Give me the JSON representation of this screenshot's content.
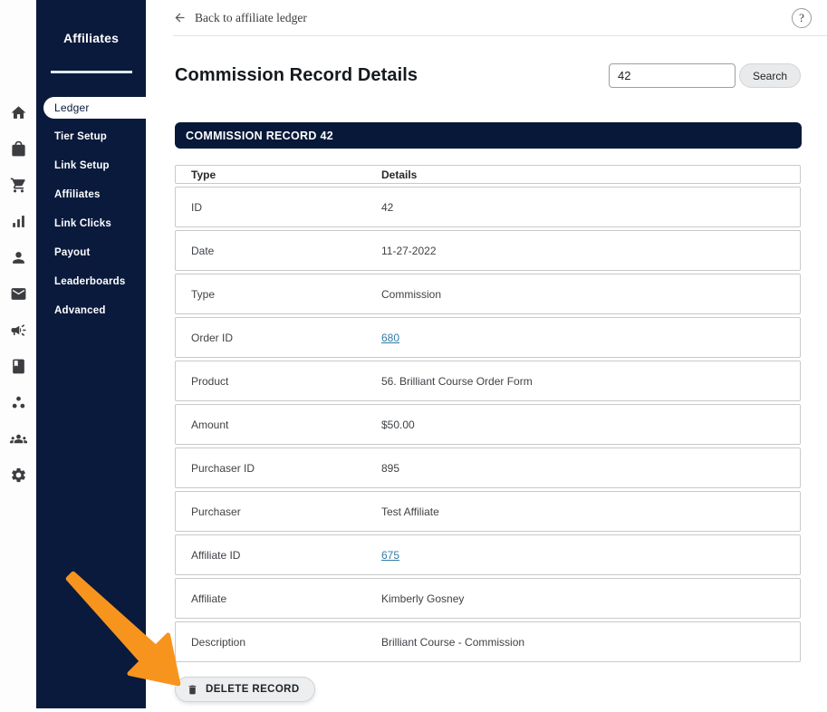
{
  "colors": {
    "navy": "#0A1A3C",
    "panel_navy": "#071838",
    "accent_orange": "#F7941E",
    "link_blue": "#337CA8"
  },
  "rail": {
    "icons": [
      "home-icon",
      "shop-icon",
      "cart-icon",
      "bar-chart-icon",
      "person-icon",
      "mail-icon",
      "megaphone-icon",
      "book-icon",
      "cluster-icon",
      "people-icon",
      "gear-icon"
    ]
  },
  "sidebar": {
    "title": "Affiliates",
    "items": [
      {
        "label": "Ledger",
        "active": true
      },
      {
        "label": "Tier Setup"
      },
      {
        "label": "Link Setup"
      },
      {
        "label": "Affiliates"
      },
      {
        "label": "Link Clicks"
      },
      {
        "label": "Payout"
      },
      {
        "label": "Leaderboards"
      },
      {
        "label": "Advanced"
      }
    ]
  },
  "topbar": {
    "back_label": "Back to affiliate ledger",
    "help_label": "?"
  },
  "header": {
    "title": "Commission Record Details",
    "search_value": "42",
    "search_button": "Search"
  },
  "panel": {
    "title": "COMMISSION RECORD 42"
  },
  "table": {
    "columns": {
      "type": "Type",
      "details": "Details"
    },
    "rows": [
      {
        "type": "ID",
        "details": "42"
      },
      {
        "type": "Date",
        "details": "11-27-2022"
      },
      {
        "type": "Type",
        "details": "Commission"
      },
      {
        "type": "Order ID",
        "details": "680"
      },
      {
        "type": "Product",
        "details": "56. Brilliant Course Order Form"
      },
      {
        "type": "Amount",
        "details": "$50.00"
      },
      {
        "type": "Purchaser ID",
        "details": "895"
      },
      {
        "type": "Purchaser",
        "details": "Test Affiliate"
      },
      {
        "type": "Affiliate ID",
        "details": "675"
      },
      {
        "type": "Affiliate",
        "details": "Kimberly Gosney"
      },
      {
        "type": "Description",
        "details": "Brilliant Course - Commission"
      }
    ]
  },
  "actions": {
    "delete_label": "DELETE RECORD"
  }
}
